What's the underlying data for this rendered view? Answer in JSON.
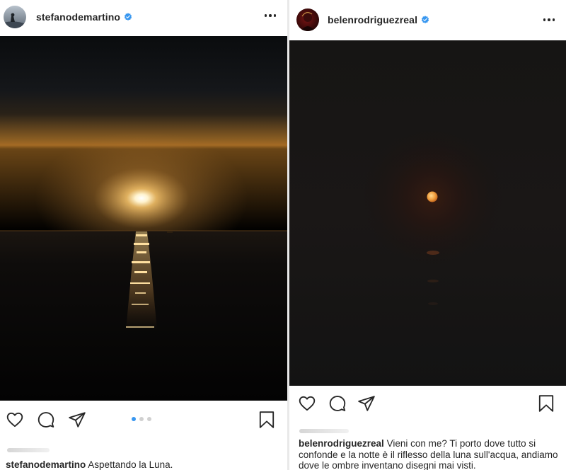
{
  "left_post": {
    "username": "stefanodemartino",
    "caption_username": "stefanodemartino",
    "caption_text": "Aspettando la Luna.",
    "carousel": {
      "total": 3,
      "active": 1
    }
  },
  "right_post": {
    "username": "belenrodriguezreal",
    "caption_username": "belenrodriguezreal",
    "caption_text": "Vieni con me? Ti porto dove tutto si confonde e la notte è il riflesso della luna sull'acqua, andiamo dove le ombre inventano disegni mai visti."
  },
  "colors": {
    "verified_badge": "#3897f0",
    "carousel_active": "#3897f0",
    "carousel_inactive": "#d0d0d0",
    "text": "#262626"
  },
  "icons": {
    "like": "heart-icon",
    "comment": "comment-bubble-icon",
    "share": "paper-plane-icon",
    "save": "bookmark-icon",
    "options": "more-horizontal-icon",
    "verified": "verified-badge-icon"
  }
}
